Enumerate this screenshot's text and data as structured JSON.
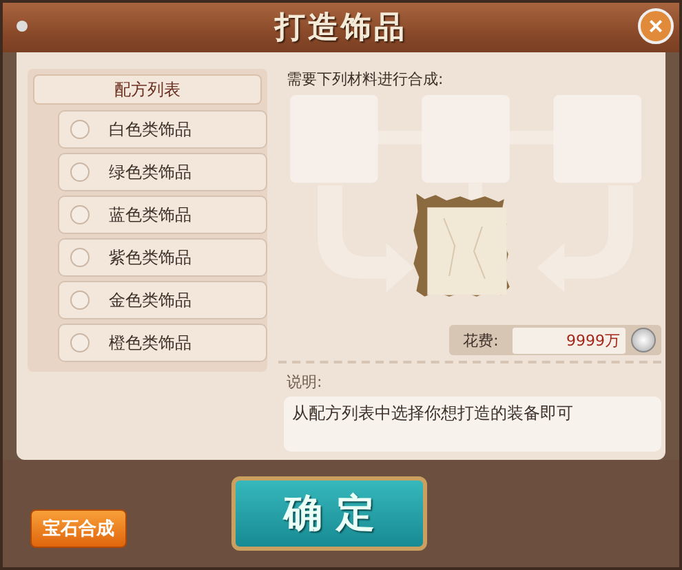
{
  "window": {
    "title": "打造饰品",
    "close": "×"
  },
  "recipe_list": {
    "title": "配方列表",
    "items": [
      {
        "label": "白色类饰品",
        "selected": false
      },
      {
        "label": "绿色类饰品",
        "selected": false
      },
      {
        "label": "蓝色类饰品",
        "selected": false
      },
      {
        "label": "紫色类饰品",
        "selected": false
      },
      {
        "label": "金色类饰品",
        "selected": false
      },
      {
        "label": "橙色类饰品",
        "selected": false
      }
    ]
  },
  "materials": {
    "label": "需要下列材料进行合成:"
  },
  "cost": {
    "label": "花费:",
    "value": "9999万"
  },
  "description": {
    "label": "说明:",
    "text": "从配方列表中选择你想打造的装备即可"
  },
  "buttons": {
    "gem": "宝石合成",
    "confirm": "确 定"
  }
}
